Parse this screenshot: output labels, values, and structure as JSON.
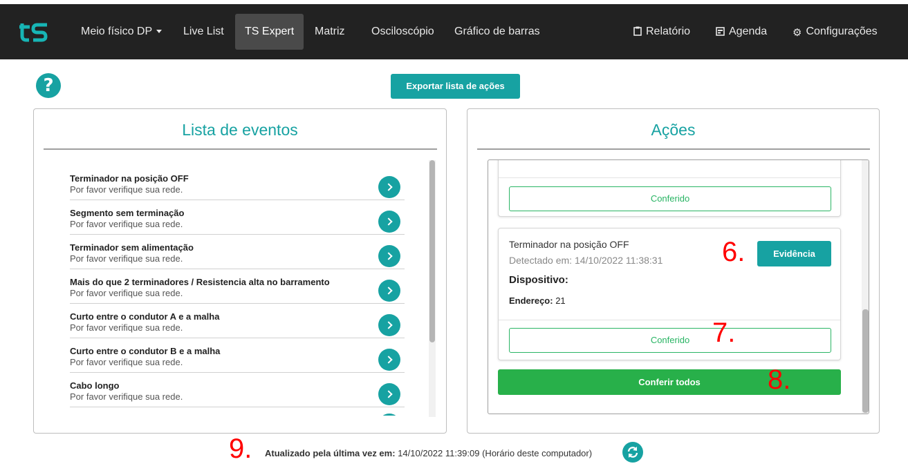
{
  "navbar": {
    "logo_text": "ts",
    "items": [
      {
        "label": "Meio físico DP",
        "dropdown": true
      },
      {
        "label": "Live List"
      },
      {
        "label": "TS Expert",
        "active": true
      },
      {
        "label": "Matriz"
      },
      {
        "label": "Osciloscópio"
      },
      {
        "label": "Gráfico de barras"
      }
    ],
    "right_items": [
      {
        "label": "Relatório",
        "icon": "clipboard-icon"
      },
      {
        "label": "Agenda",
        "icon": "calendar-icon"
      },
      {
        "label": "Configurações",
        "icon": "gear-icon"
      }
    ]
  },
  "toolbar": {
    "help": "?",
    "export_label": "Exportar lista de ações"
  },
  "events_panel": {
    "title": "Lista de eventos",
    "items": [
      {
        "title": "Terminador na posição OFF",
        "subtitle": "Por favor verifique sua rede."
      },
      {
        "title": "Segmento sem terminação",
        "subtitle": "Por favor verifique sua rede."
      },
      {
        "title": "Terminador sem alimentação",
        "subtitle": "Por favor verifique sua rede."
      },
      {
        "title": "Mais do que 2 terminadores / Resistencia alta no barramento",
        "subtitle": "Por favor verifique sua rede."
      },
      {
        "title": "Curto entre o condutor A e a malha",
        "subtitle": "Por favor verifique sua rede."
      },
      {
        "title": "Curto entre o condutor B e a malha",
        "subtitle": "Por favor verifique sua rede."
      },
      {
        "title": "Cabo longo",
        "subtitle": "Por favor verifique sua rede."
      }
    ]
  },
  "actions_panel": {
    "title": "Ações",
    "card1": {
      "confer_label": "Conferido"
    },
    "card2": {
      "title": "Terminador na posição OFF",
      "detected": "Detectado em: 14/10/2022 11:38:31",
      "device_label": "Dispositivo:",
      "address_label": "Endereço:",
      "address_value": "21",
      "evidence_label": "Evidência",
      "confer_label": "Conferido"
    },
    "confer_all_label": "Conferir todos"
  },
  "markers": {
    "m6": "6.",
    "m7": "7.",
    "m8": "8.",
    "m9": "9."
  },
  "footer": {
    "label": "Atualizado pela última vez em:",
    "value": "14/10/2022 11:39:09 (Horário deste computador)"
  },
  "colors": {
    "accent": "#17a2a2",
    "success": "#28b04a",
    "navbar": "#222222",
    "marker": "#ff0000"
  }
}
